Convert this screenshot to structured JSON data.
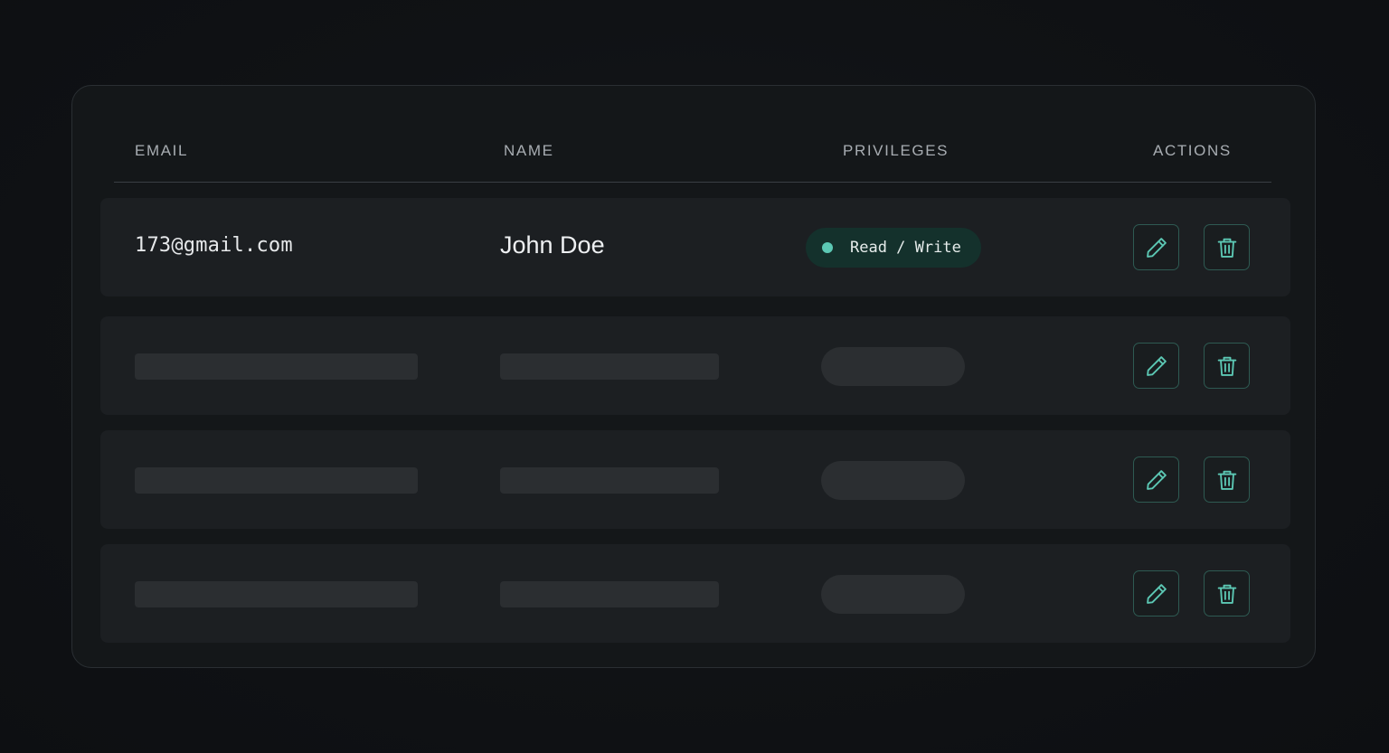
{
  "table": {
    "headers": {
      "email": "EMAIL",
      "name": "NAME",
      "privileges": "PRIVILEGES",
      "actions": "ACTIONS"
    },
    "rows": [
      {
        "email": "173@gmail.com",
        "name": "John Doe",
        "privilege": "Read / Write",
        "loading": false
      },
      {
        "loading": true
      },
      {
        "loading": true
      },
      {
        "loading": true
      }
    ]
  },
  "icons": {
    "edit": "pencil-icon",
    "delete": "trash-icon",
    "privilege_status": "status-dot"
  },
  "colors": {
    "accent": "#5cc8b4",
    "badge_background": "#14312c",
    "button_border": "#2e5a52",
    "skeleton": "#2b2e31",
    "row_background": "#1c1f22",
    "card_background": "#141719"
  }
}
